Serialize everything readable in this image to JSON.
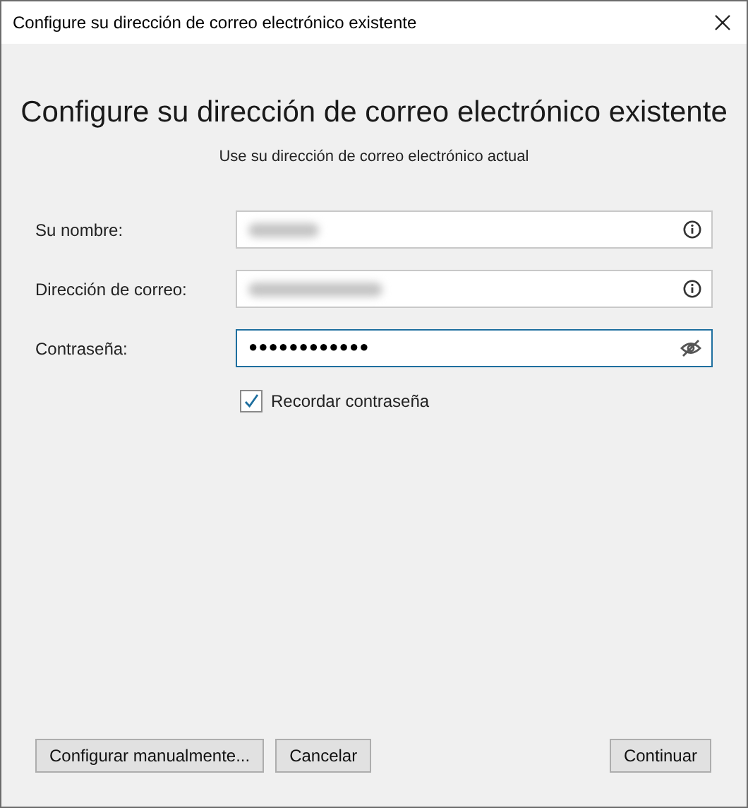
{
  "window": {
    "title": "Configure su dirección de correo electrónico existente"
  },
  "heading": "Configure su dirección de correo electrónico existente",
  "subheading": "Use su dirección de correo electrónico actual",
  "fields": [
    {
      "label": "Su nombre:",
      "kind": "text",
      "value_blurred": true,
      "focused": false
    },
    {
      "label": "Dirección de correo:",
      "kind": "text",
      "value_blurred": true,
      "focused": false
    },
    {
      "label": "Contraseña:",
      "kind": "password",
      "value": "●●●●●●●●●●●●",
      "focused": true
    }
  ],
  "remember": {
    "label": "Recordar contraseña",
    "checked": true
  },
  "buttons": [
    {
      "label": "Configurar manualmente..."
    },
    {
      "label": "Cancelar"
    },
    {
      "label": "Continuar"
    }
  ]
}
